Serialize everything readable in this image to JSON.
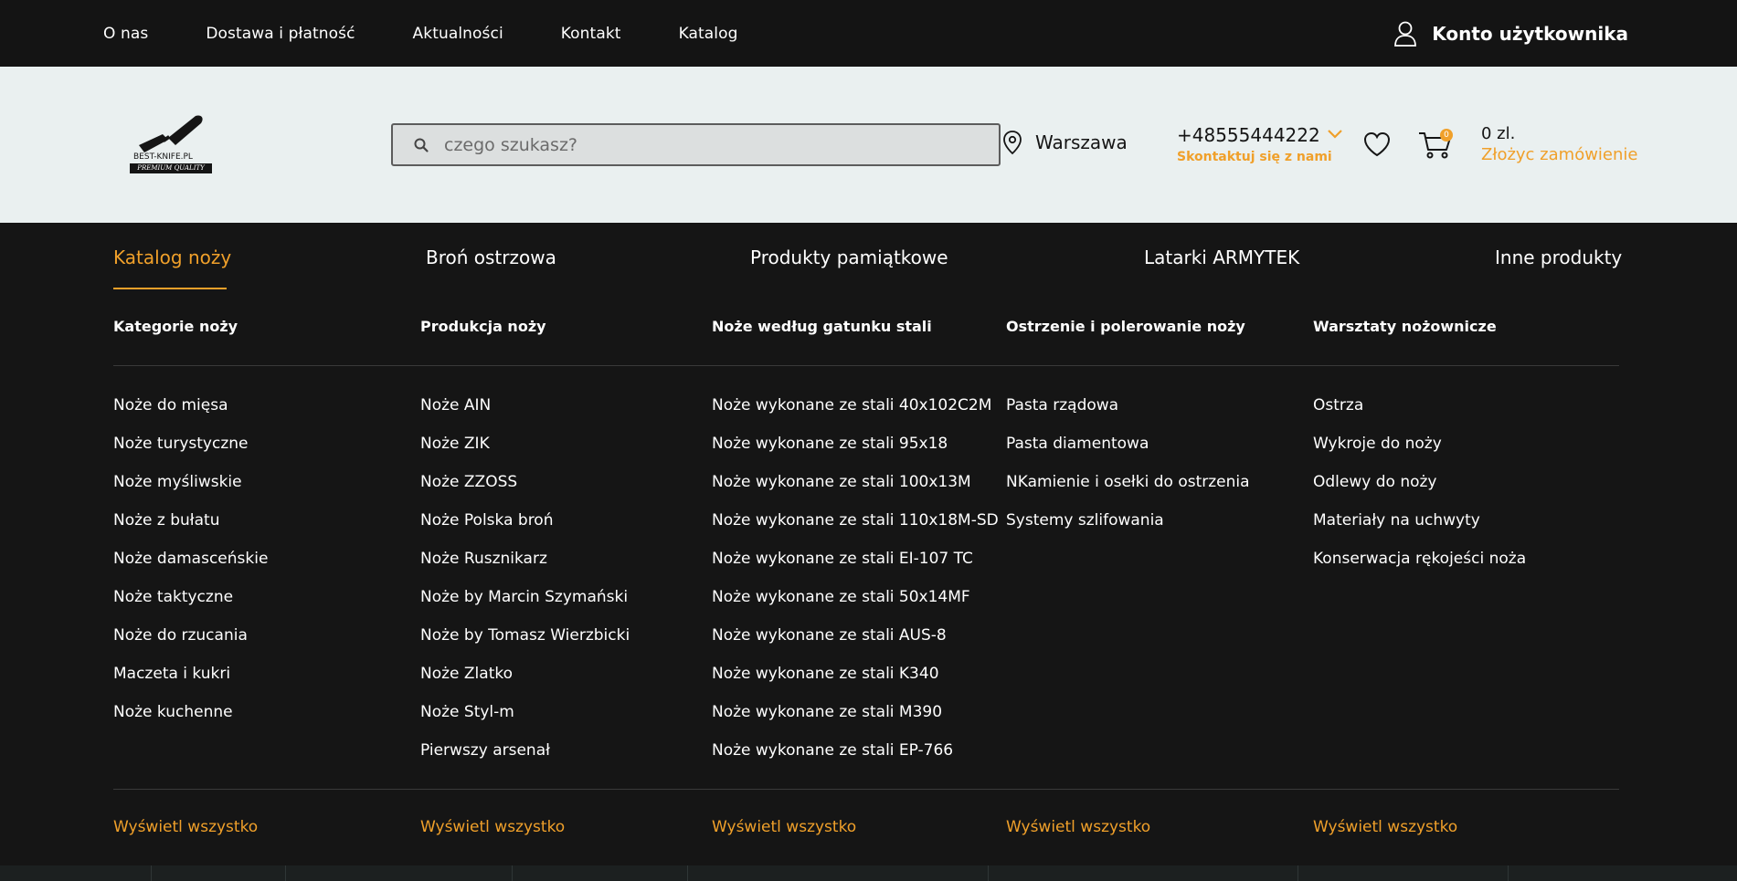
{
  "topnav": {
    "items": [
      {
        "label": "O nas"
      },
      {
        "label": "Dostawa i płatność"
      },
      {
        "label": "Aktualności"
      },
      {
        "label": "Kontakt"
      },
      {
        "label": "Katalog"
      }
    ],
    "account_label": "Konto użytkownika"
  },
  "header": {
    "logo_text": "BEST-KNIFE.PL",
    "logo_tagline": "PREMIUM QUALITY",
    "search_placeholder": "czego szukasz?",
    "search_value": "",
    "city": "Warszawa",
    "phone": "+48555444222",
    "contact_label": "Skontaktuj się z nami",
    "cart_count": "0",
    "cart_total": "0 zl.",
    "order_label": "Złożyc zamówienie",
    "accent_color": "#f0a02a"
  },
  "categories": [
    {
      "label": "Katalog noży",
      "active": true
    },
    {
      "label": "Broń ostrzowa"
    },
    {
      "label": "Produkty pamiątkowe"
    },
    {
      "label": "Latarki ARMYTEK"
    },
    {
      "label": "Inne produkty"
    }
  ],
  "columns": [
    {
      "heading": "Kategorie noży",
      "items": [
        "Noże do mięsa",
        "Noże turystyczne",
        "Noże myśliwskie",
        "Noże z bułatu",
        "Noże damasceńskie",
        "Noże taktyczne",
        "Noże do rzucania",
        "Maczeta i kukri",
        "Noże kuchenne"
      ],
      "view_all": "Wyświetl wszystko"
    },
    {
      "heading": "Produkcja noży",
      "items": [
        "Noże AIN",
        "Noże ZIK",
        "Noże ZZOSS",
        "Noże Polska broń",
        "Noże Rusznikarz",
        "Noże by Marcin Szymański",
        "Noże by Tomasz Wierzbicki",
        "Noże Zlatko",
        "Noże Styl-m",
        "Pierwszy arsenał"
      ],
      "view_all": "Wyświetl wszystko"
    },
    {
      "heading": "Noże według gatunku stali",
      "items": [
        "Noże wykonane ze stali 40x102C2M",
        "Noże wykonane ze stali 95x18",
        "Noże wykonane ze stali 100x13M",
        "Noże wykonane ze stali 110x18M-SD",
        "Noże wykonane ze stali EI-107 TC",
        "Noże wykonane ze stali 50x14MF",
        "Noże wykonane ze stali AUS-8",
        "Noże wykonane ze stali K340",
        "Noże wykonane ze stali M390",
        "Noże wykonane ze stali EP-766"
      ],
      "view_all": "Wyświetl wszystko"
    },
    {
      "heading": "Ostrzenie i polerowanie noży",
      "items": [
        "Pasta rządowa",
        "Pasta diamentowa",
        "NKamienie i osełki do ostrzenia",
        "Systemy szlifowania"
      ],
      "view_all": "Wyświetl wszystko"
    },
    {
      "heading": "Warsztaty nożownicze",
      "items": [
        "Ostrza",
        "Wykroje do noży",
        "Odlewy do noży",
        "Materiały na uchwyty",
        "Konserwacja rękojeści noża"
      ],
      "view_all": "Wyświetl wszystko"
    }
  ]
}
